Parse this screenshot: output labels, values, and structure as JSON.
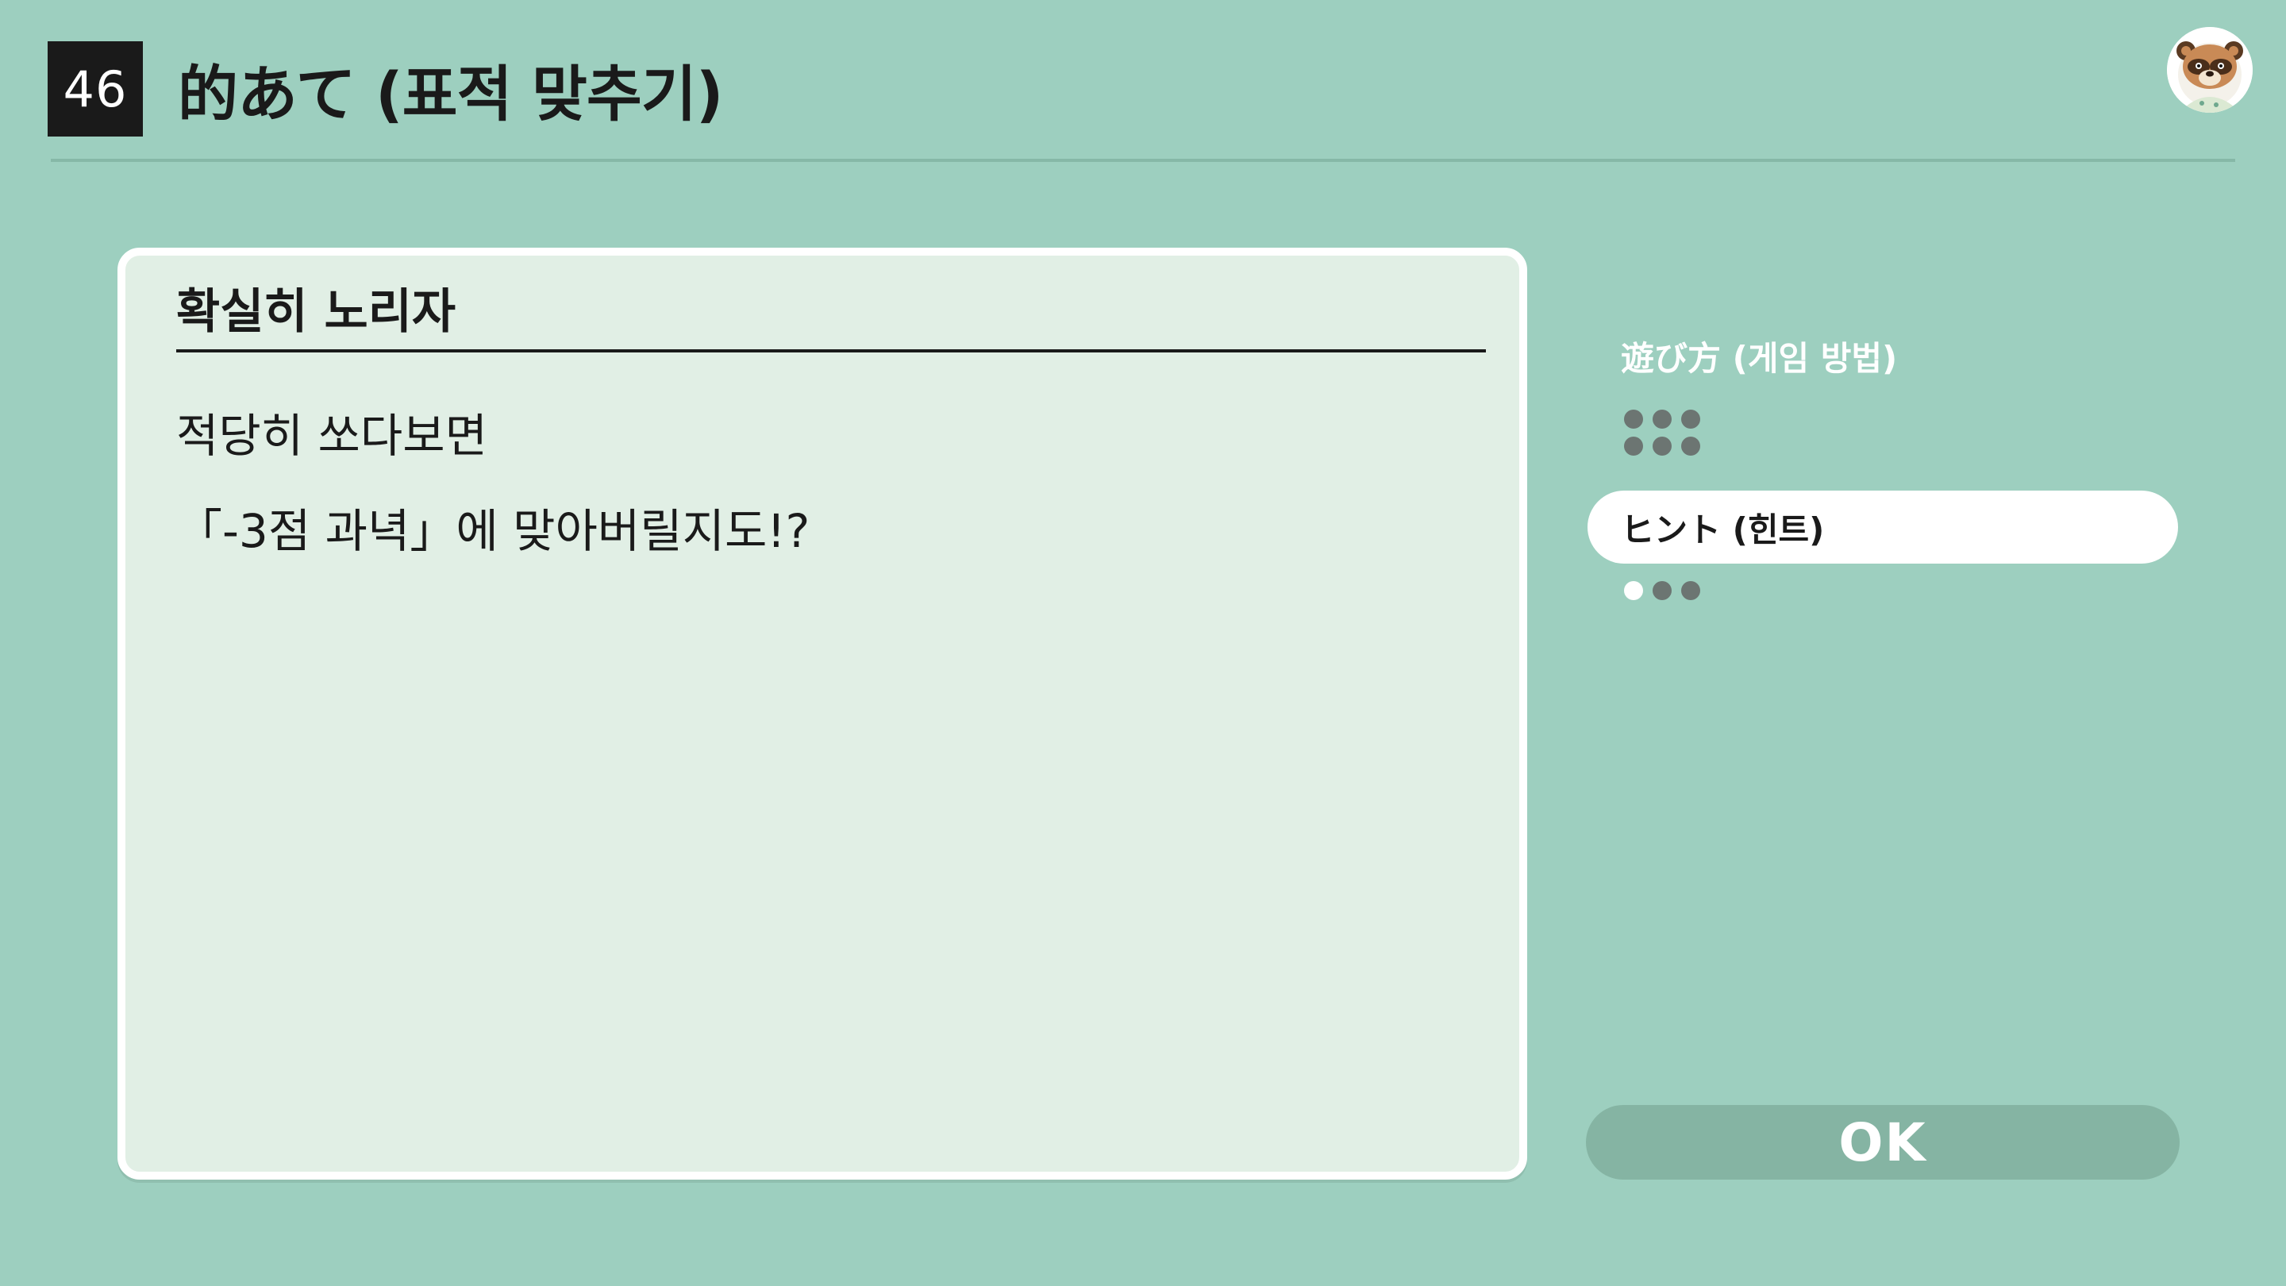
{
  "header": {
    "number": "46",
    "title": "的あて (표적 맞추기)"
  },
  "card": {
    "heading": "확실히 노리자",
    "lines": [
      "적당히 쏘다보면",
      "「-3점 과녁」에 맞아버릴지도!?"
    ]
  },
  "menu": {
    "items": [
      {
        "label": "遊び方 (게임 방법)",
        "selected": false,
        "page_count": 6,
        "current_page": 0
      },
      {
        "label": "ヒント (힌트)",
        "selected": true,
        "page_count": 3,
        "current_page": 1
      }
    ]
  },
  "ok_label": "OK",
  "avatar_icon": "tom-nook-avatar-icon",
  "colors": {
    "background": "#9dcfbf",
    "card": "#e1efe5",
    "ok_button": "#85b4a3",
    "selected_item": "#ffffff",
    "dot_inactive": "#6c7572",
    "dot_active": "#ffffff"
  }
}
